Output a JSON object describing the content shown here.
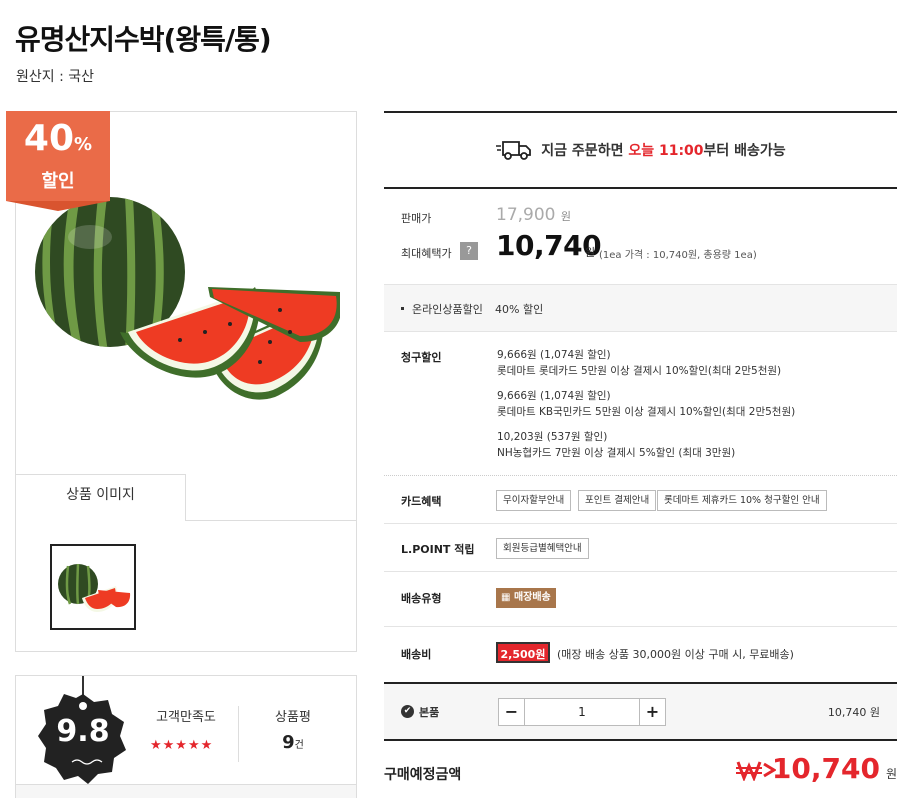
{
  "product": {
    "title": "유명산지수박(왕특/통)",
    "origin": "원산지 : 국산"
  },
  "badge": {
    "percent": "40",
    "percent_unit": "%",
    "label": "할인"
  },
  "image_tab": {
    "label": "상품 이미지"
  },
  "rating": {
    "score": "9.8",
    "satisfaction_label": "고객만족도",
    "stars": "★★★★★",
    "stars_value": 5,
    "review_label": "상품평",
    "review_count": "9",
    "review_unit": "건"
  },
  "shipping_banner": {
    "prefix": "지금 주문하면 ",
    "highlight": "오늘 11:00",
    "suffix": "부터 배송가능"
  },
  "price": {
    "sale_label": "판매가",
    "original": "17,900",
    "original_unit": "원",
    "benefit_label": "최대혜택가",
    "help_icon": "?",
    "final": "10,740",
    "final_unit": "원",
    "note": "(1ea 가격 : 10,740원, 총용량 1ea)"
  },
  "online_discount": {
    "label": "온라인상품할인",
    "value": "40% 할인"
  },
  "billing_discount": {
    "label": "청구할인",
    "items": [
      {
        "line1": "9,666원 (1,074원 할인)",
        "line2": "롯데마트 롯데카드 5만원 이상 결제시 10%할인(최대 2만5천원)"
      },
      {
        "line1": "9,666원 (1,074원 할인)",
        "line2": "롯데마트 KB국민카드 5만원 이상 결제시 10%할인(최대 2만5천원)"
      },
      {
        "line1": "10,203원 (537원 할인)",
        "line2": "NH농협카드 7만원 이상 결제시 5%할인 (최대 3만원)"
      }
    ]
  },
  "card_benefit": {
    "label": "카드혜택",
    "buttons": [
      "무이자할부안내",
      "포인트 결제안내",
      "롯데마트 제휴카드 10% 청구할인 안내"
    ]
  },
  "lpoint": {
    "label": "L.POINT 적립",
    "button": "회원등급별혜택안내"
  },
  "delivery_type": {
    "label": "배송유형",
    "badge": "매장배송"
  },
  "delivery_fee": {
    "label": "배송비",
    "fee": "2,500원",
    "note": "(매장 배송 상품 30,000원 이상 구매 시, 무료배송)"
  },
  "quantity": {
    "item_name": "본품",
    "minus": "−",
    "value": "1",
    "plus": "+",
    "amount": "10,740 원"
  },
  "total": {
    "label": "구매예정금액",
    "value": "10,740",
    "unit": "원"
  },
  "colors": {
    "accent_red": "#e4262c",
    "badge_orange": "#ea6b48",
    "store_brown": "#a8764b"
  }
}
